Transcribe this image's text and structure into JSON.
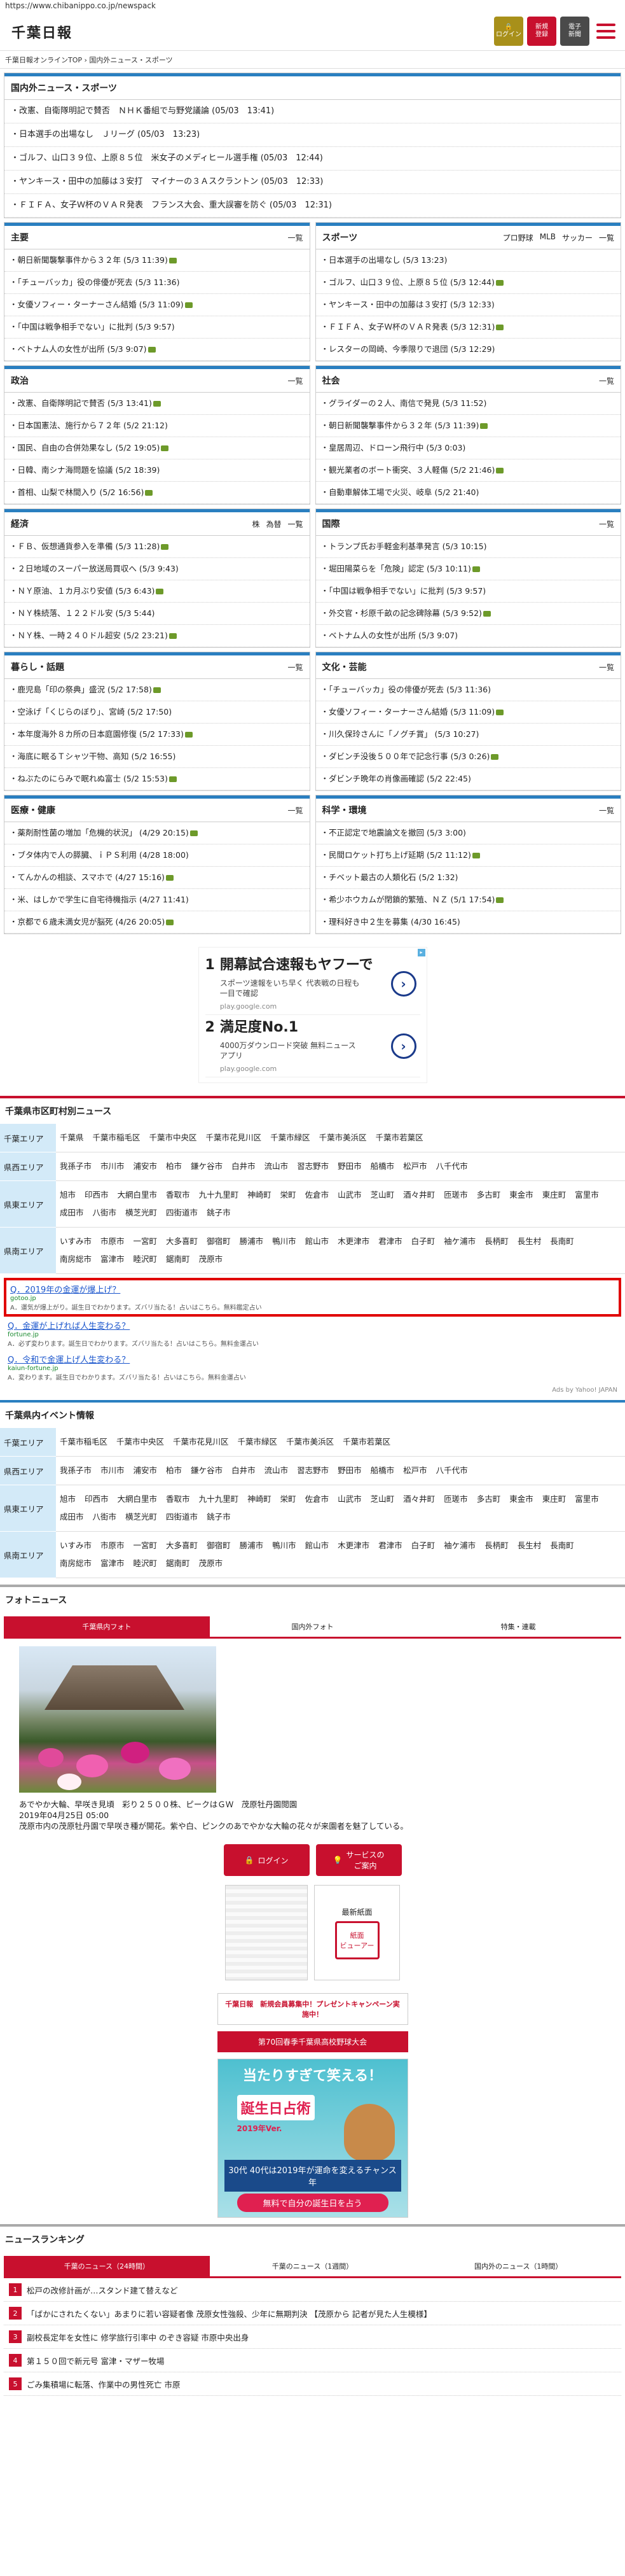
{
  "browser": {
    "url": "https://www.chibanippo.co.jp/newspack"
  },
  "header": {
    "logo": "千葉日報",
    "login": "ログイン",
    "register": "新規\n登録",
    "epaper": "電子\n新聞"
  },
  "breadcrumb": "千葉日報オンラインTOP › 国内外ニュース・スポーツ",
  "top_news": {
    "title": "国内外ニュース・スポーツ",
    "items": [
      "改憲、自衛隊明記で賛否　ＮＨＫ番組で与野党議論 (05/03　13:41)",
      "日本選手の出場なし　Ｊリーグ (05/03　13:23)",
      "ゴルフ、山口３９位、上原８５位　米女子のメディヒール選手権 (05/03　12:44)",
      "ヤンキース・田中の加藤は３安打　マイナーの３Ａスクラントン (05/03　12:33)",
      "ＦＩＦＡ、女子Ｗ杯のＶＡＲ発表　フランス大会、重大誤審を防ぐ (05/03　12:31)"
    ]
  },
  "cat_rows": [
    {
      "left": {
        "title": "主要",
        "more": "一覧",
        "items": [
          "朝日新聞襲撃事件から３２年 (5/3 11:39)",
          "「チューバッカ」役の俳優が死去 (5/3 11:36)",
          "女優ソフィー・ターナーさん結婚 (5/3 11:09)",
          "「中国は戦争相手でない」に批判 (5/3 9:57)",
          "ベトナム人の女性が出所 (5/3 9:07)"
        ]
      },
      "right": {
        "title": "スポーツ",
        "subs": [
          "プロ野球",
          "MLB",
          "サッカー",
          "一覧"
        ],
        "items": [
          "日本選手の出場なし (5/3 13:23)",
          "ゴルフ、山口３９位、上原８５位 (5/3 12:44)",
          "ヤンキース・田中の加藤は３安打 (5/3 12:33)",
          "ＦＩＦＡ、女子Ｗ杯のＶＡＲ発表 (5/3 12:31)",
          "レスターの岡崎、今季限りで退団 (5/3 12:29)"
        ]
      }
    },
    {
      "left": {
        "title": "政治",
        "more": "一覧",
        "items": [
          "改憲、自衛隊明記で賛否 (5/3 13:41)",
          "日本国憲法、施行から７２年 (5/2 21:12)",
          "国民、自由の合併効果なし (5/2 19:05)",
          "日韓、南シナ海問題を協議 (5/2 18:39)",
          "首相、山梨で林間入り (5/2 16:56)"
        ]
      },
      "right": {
        "title": "社会",
        "more": "一覧",
        "items": [
          "グライダーの２人、南信で発見 (5/3 11:52)",
          "朝日新聞襲撃事件から３２年 (5/3 11:39)",
          "皇居周辺、ドローン飛行中 (5/3 0:03)",
          "観光業者のボート衝突、３人軽傷 (5/2 21:46)",
          "自動車解体工場で火災、岐阜 (5/2 21:40)"
        ]
      }
    },
    {
      "left": {
        "title": "経済",
        "subs": [
          "株",
          "為替",
          "一覧"
        ],
        "items": [
          "ＦＢ、仮想通貨参入を準備 (5/3 11:28)",
          "２日地域のスーパー放送局買収へ (5/3 9:43)",
          "ＮＹ原油、１カ月ぶり安値 (5/3 6:43)",
          "ＮＹ株続落、１２２ドル安 (5/3 5:44)",
          "ＮＹ株、一時２４０ドル超安 (5/2 23:21)"
        ]
      },
      "right": {
        "title": "国際",
        "more": "一覧",
        "items": [
          "トランプ氏お手軽金利基準発言 (5/3 10:15)",
          "堀田陽菜らを「危険」認定 (5/3 10:11)",
          "「中国は戦争相手でない」に批判 (5/3 9:57)",
          "外交官・杉原千畝の記念碑除幕 (5/3 9:52)",
          "ベトナム人の女性が出所 (5/3 9:07)"
        ]
      }
    },
    {
      "left": {
        "title": "暮らし・話題",
        "more": "一覧",
        "items": [
          "鹿児島「印の祭典」盛況 (5/2 17:58)",
          "空泳げ「くじらのぼり」、宮崎 (5/2 17:50)",
          "本年度海外８カ所の日本庭園修復 (5/2 17:33)",
          "海底に眠るＴシャツ干物、高知 (5/2 16:55)",
          "ねぶたのにらみで眠れぬ富士 (5/2 15:53)"
        ]
      },
      "right": {
        "title": "文化・芸能",
        "more": "一覧",
        "items": [
          "「チューバッカ」役の俳優が死去 (5/3 11:36)",
          "女優ソフィー・ターナーさん結婚 (5/3 11:09)",
          "川久保玲さんに「ノグチ賞」 (5/3 10:27)",
          "ダビンチ没後５００年で記念行事 (5/3 0:26)",
          "ダビンチ晩年の肖像画確認 (5/2 22:45)"
        ]
      }
    },
    {
      "left": {
        "title": "医療・健康",
        "more": "一覧",
        "items": [
          "薬剤耐性菌の増加「危機的状況」 (4/29 20:15)",
          "ブタ体内で人の膵臓、ｉＰＳ利用 (4/28 18:00)",
          "てんかんの相談、スマホで (4/27 15:16)",
          "米、はしかで学生に自宅待機指示 (4/27 11:41)",
          "京都で６歳未満女児が脳死 (4/26 20:05)"
        ]
      },
      "right": {
        "title": "科学・環境",
        "more": "一覧",
        "items": [
          "不正認定で地震論文を撤回 (5/3 3:00)",
          "民間ロケット打ち上げ延期 (5/2 11:12)",
          "チベット最古の人類化石 (5/2 1:32)",
          "希少ホウカムが閉鎖的繁殖、ＮＺ (5/1 17:54)",
          "理科好き中２生を募集 (4/30 16:45)"
        ]
      }
    }
  ],
  "ad": {
    "items": [
      {
        "num": "1",
        "title": "開幕試合速報もヤフーで",
        "desc": "スポーツ速報をいち早く 代表戦の日程も一目で確認",
        "url": "play.google.com"
      },
      {
        "num": "2",
        "title": "満足度No.1",
        "desc": "4000万ダウンロード突破 無料ニュースアプリ",
        "url": "play.google.com"
      }
    ]
  },
  "areas": {
    "title": "千葉県市区町村別ニュース",
    "rows": [
      {
        "label": "千葉エリア",
        "cities": [
          "千葉県",
          "千葉市稲毛区",
          "千葉市中央区",
          "千葉市花見川区",
          "千葉市緑区",
          "千葉市美浜区",
          "千葉市若葉区"
        ]
      },
      {
        "label": "県西エリア",
        "cities": [
          "我孫子市",
          "市川市",
          "浦安市",
          "柏市",
          "鎌ケ谷市",
          "白井市",
          "流山市",
          "習志野市",
          "野田市",
          "船橋市",
          "松戸市",
          "八千代市"
        ]
      },
      {
        "label": "県東エリア",
        "cities": [
          "旭市",
          "印西市",
          "大網白里市",
          "香取市",
          "九十九里町",
          "神崎町",
          "栄町",
          "佐倉市",
          "山武市",
          "芝山町",
          "酒々井町",
          "匝瑳市",
          "多古町",
          "東金市",
          "東庄町",
          "富里市",
          "成田市",
          "八街市",
          "横芝光町",
          "四街道市",
          "銚子市"
        ]
      },
      {
        "label": "県南エリア",
        "cities": [
          "いすみ市",
          "市原市",
          "一宮町",
          "大多喜町",
          "御宿町",
          "勝浦市",
          "鴨川市",
          "館山市",
          "木更津市",
          "君津市",
          "白子町",
          "袖ケ浦市",
          "長柄町",
          "長生村",
          "長南町",
          "南房総市",
          "富津市",
          "睦沢町",
          "鋸南町",
          "茂原市"
        ]
      }
    ]
  },
  "yahoo_ads": {
    "items": [
      {
        "title": "Q．2019年の金運が爆上げ？",
        "url": "gotoo.jp",
        "desc": "A．運気が爆上がり。誕生日でわかります。ズバリ当たる！占いはこちら。無料鑑定占い"
      },
      {
        "title": "Q．金運が上げれば人生変わる？",
        "url": "fortune.jp",
        "desc": "A．必ず変わります。誕生日でわかります。ズバリ当たる！占いはこちら。無料金運占い"
      },
      {
        "title": "Q．令和で金運上げ人生変わる？",
        "url": "kaiun-fortune.jp",
        "desc": "A．変わります。誕生日でわかります。ズバリ当たる！占いはこちら。無料金運占い"
      }
    ],
    "by": "Ads by Yahoo! JAPAN"
  },
  "events": {
    "title": "千葉県内イベント情報",
    "rows": [
      {
        "label": "千葉エリア",
        "cities": [
          "千葉市稲毛区",
          "千葉市中央区",
          "千葉市花見川区",
          "千葉市緑区",
          "千葉市美浜区",
          "千葉市若葉区"
        ]
      },
      {
        "label": "県西エリア",
        "cities": [
          "我孫子市",
          "市川市",
          "浦安市",
          "柏市",
          "鎌ケ谷市",
          "白井市",
          "流山市",
          "習志野市",
          "野田市",
          "船橋市",
          "松戸市",
          "八千代市"
        ]
      },
      {
        "label": "県東エリア",
        "cities": [
          "旭市",
          "印西市",
          "大網白里市",
          "香取市",
          "九十九里町",
          "神崎町",
          "栄町",
          "佐倉市",
          "山武市",
          "芝山町",
          "酒々井町",
          "匝瑳市",
          "多古町",
          "東金市",
          "東庄町",
          "富里市",
          "成田市",
          "八街市",
          "横芝光町",
          "四街道市",
          "銚子市"
        ]
      },
      {
        "label": "県南エリア",
        "cities": [
          "いすみ市",
          "市原市",
          "一宮町",
          "大多喜町",
          "御宿町",
          "勝浦市",
          "鴨川市",
          "館山市",
          "木更津市",
          "君津市",
          "白子町",
          "袖ケ浦市",
          "長柄町",
          "長生村",
          "長南町",
          "南房総市",
          "富津市",
          "睦沢町",
          "鋸南町",
          "茂原市"
        ]
      }
    ]
  },
  "photo_news": {
    "title": "フォトニュース",
    "tabs": [
      "千葉県内フォト",
      "国内外フォト",
      "特集・連載"
    ],
    "caption_title": "あでやか大輪、早咲き見頃　彩り２５００株、ピークはＧＷ　茂原牡丹園閲園",
    "caption_date": "2019年04月25日 05:00",
    "caption_text": "茂原市内の茂原牡丹園で早咲き種が開花。紫や白、ピンクのあでやかな大輪の花々が来園者を魅了している。"
  },
  "side": {
    "login": "ログイン",
    "service": "サービスの\nご案内",
    "latest": "最新紙面",
    "viewer": "紙面\nビューアー",
    "banner1": "千葉日報　新規会員募集中！プレゼントキャンペーン実施中！",
    "banner2": "第70回春季千葉県高校野球大会",
    "bday1": "当たりすぎて笑える！",
    "bday2": "誕生日占術",
    "bday3": "2019年Ver.",
    "bday4": "30代 40代は2019年が運命を変えるチャンス年",
    "bday5": "無料で自分の誕生日を占う"
  },
  "ranking": {
    "title": "ニュースランキング",
    "tabs": [
      "千葉のニュース（24時間）",
      "千葉のニュース（1週間）",
      "国内外のニュース（1時間）"
    ],
    "items": [
      {
        "num": "1",
        "text": "松戸の改修計画が…スタンド建て替えなど"
      },
      {
        "num": "2",
        "text": "「ばかにされたくない」あまりに若い容疑者像 茂原女性強殺、少年に無期判決 【茂原から 記者が見た人生模様】"
      },
      {
        "num": "3",
        "text": "副校長定年を女性に 修学旅行引率中 のぞき容疑 市原中央出身"
      },
      {
        "num": "4",
        "text": "第１５０回で新元号 富津・マザー牧場"
      },
      {
        "num": "5",
        "text": "ごみ集積場に転落、作業中の男性死亡 市原"
      }
    ]
  }
}
